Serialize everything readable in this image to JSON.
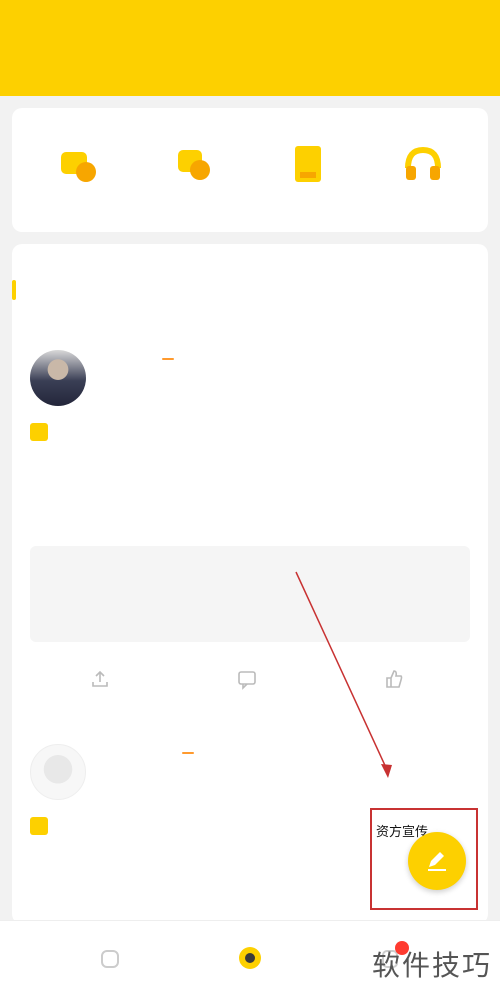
{
  "status_bar": {
    "left": "",
    "time": "",
    "right": ""
  },
  "header": {
    "title": ""
  },
  "quick_links": [
    {
      "label": "",
      "icon": "coin-stack-icon"
    },
    {
      "label": "",
      "icon": "coin-exchange-icon"
    },
    {
      "label": "",
      "icon": "document-icon"
    },
    {
      "label": "",
      "icon": "headset-icon"
    }
  ],
  "section": {
    "title": "",
    "more": ""
  },
  "posts": [
    {
      "author": "",
      "badge": "",
      "time": "",
      "body": "",
      "more_link": "",
      "quote_title": "",
      "quote_sub": "",
      "actions": [
        "",
        "",
        ""
      ]
    },
    {
      "author": "",
      "badge": "",
      "time": "",
      "body": ""
    }
  ],
  "overlay_text": "资方宣传",
  "tabs": [
    {
      "label": "",
      "icon": "home-icon"
    },
    {
      "label": "",
      "icon": "bulb-icon"
    },
    {
      "label": "",
      "icon": "profile-icon"
    }
  ],
  "watermark": "软件技巧",
  "colors": {
    "brand_yellow": "#fdd000",
    "badge_orange": "#ff9a2e",
    "annotation_red": "#c83232"
  }
}
